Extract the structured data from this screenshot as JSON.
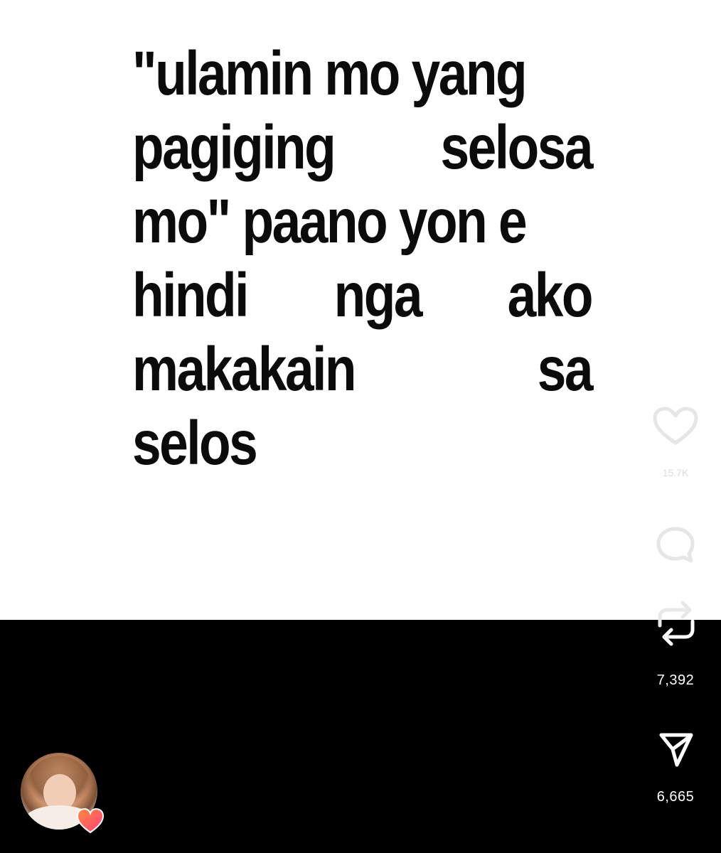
{
  "post": {
    "caption_lines": [
      {
        "words": [
          "\"ulamin mo yang"
        ],
        "align": "left"
      },
      {
        "words": [
          "pagiging",
          "selosa"
        ],
        "align": "justify"
      },
      {
        "words": [
          "mo\" paano yon e"
        ],
        "align": "left"
      },
      {
        "words": [
          "hindi",
          "nga",
          "ako"
        ],
        "align": "justify"
      },
      {
        "words": [
          "makakain",
          "sa"
        ],
        "align": "justify"
      },
      {
        "words": [
          "selos"
        ],
        "align": "left"
      }
    ],
    "background_color": "#ffffff",
    "text_color": "#0b0b0b"
  },
  "actions": {
    "like": {
      "icon": "heart-icon",
      "count": "15.7K"
    },
    "comment": {
      "icon": "comment-bubble-icon"
    },
    "repost": {
      "icon": "repost-icon",
      "count": "7,392"
    },
    "share": {
      "icon": "paper-plane-icon",
      "count": "6,665"
    }
  },
  "author": {
    "avatar_icon": "profile-avatar",
    "badge_icon": "heart-badge-icon",
    "badge_colors": [
      "#ff3d7f",
      "#ff8a3d"
    ]
  },
  "theme": {
    "background": "#000000",
    "icon_color": "#ffffff"
  }
}
